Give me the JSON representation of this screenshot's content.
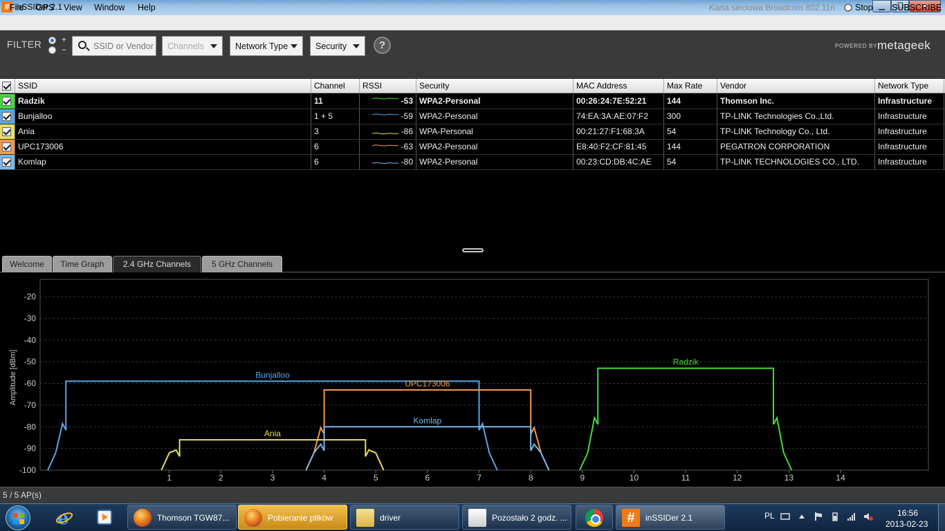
{
  "window": {
    "title": "inSSIDer 2.1",
    "app_icon": "#",
    "min_glyph": "▁",
    "max_glyph": "❐",
    "close_glyph": "✕"
  },
  "menu": {
    "items": [
      "File",
      "GPS",
      "View",
      "Window",
      "Help"
    ],
    "adapter": "Karta sieciowa Broadcom 802.11n",
    "stop": "Stop",
    "subscribe": "SUBSCRIBE"
  },
  "filter": {
    "label": "FILTER",
    "plus": "+",
    "minus": "−",
    "search_placeholder": "SSID or Vendor",
    "channels": "Channels",
    "network_type": "Network Type",
    "security": "Security",
    "help": "?",
    "powered_by": "POWERED BY",
    "brand": "metageek"
  },
  "table": {
    "columns": [
      "SSID",
      "Channel",
      "RSSI",
      "Security",
      "MAC Address",
      "Max Rate",
      "Vendor",
      "Network Type"
    ],
    "rows": [
      {
        "ssid": "Radzik",
        "channel": "11",
        "rssi": "-53",
        "security": "WPA2-Personal",
        "mac": "00:26:24:7E:52:21",
        "max_rate": "144",
        "vendor": "Thomson Inc.",
        "network_type": "Infrastructure",
        "color": "#44dd33",
        "selected": true
      },
      {
        "ssid": "Bunjalloo",
        "channel": "1 + 5",
        "rssi": "-59",
        "security": "WPA2-Personal",
        "mac": "74:EA:3A:AE:07:F2",
        "max_rate": "300",
        "vendor": "TP-LINK Technologies Co.,Ltd.",
        "network_type": "Infrastructure",
        "color": "#5aa6e6",
        "selected": false
      },
      {
        "ssid": "Ania",
        "channel": "3",
        "rssi": "-86",
        "security": "WPA-Personal",
        "mac": "00:21:27:F1:68:3A",
        "max_rate": "54",
        "vendor": "TP-LINK Technology Co., Ltd.",
        "network_type": "Infrastructure",
        "color": "#e8e05a",
        "selected": false
      },
      {
        "ssid": "UPC173006",
        "channel": "6",
        "rssi": "-63",
        "security": "WPA2-Personal",
        "mac": "E8:40:F2:CF:81:45",
        "max_rate": "144",
        "vendor": "PEGATRON CORPORATION",
        "network_type": "Infrastructure",
        "color": "#f29a4a",
        "selected": false
      },
      {
        "ssid": "Komlap",
        "channel": "6",
        "rssi": "-80",
        "security": "WPA2-Personal",
        "mac": "00:23:CD:DB:4C:AE",
        "max_rate": "54",
        "vendor": "TP-LINK TECHNOLOGIES CO., LTD.",
        "network_type": "Infrastructure",
        "color": "#78b8ee",
        "selected": false
      }
    ]
  },
  "tabs": [
    {
      "label": "Welcome",
      "active": false
    },
    {
      "label": "Time Graph",
      "active": false
    },
    {
      "label": "2.4 GHz Channels",
      "active": true
    },
    {
      "label": "5 GHz Channels",
      "active": false
    }
  ],
  "chart_data": {
    "type": "area",
    "ylabel": "Amplitude [dBm]",
    "xlabel": "",
    "ylim": [
      -100,
      -12
    ],
    "xlim": [
      -1.5,
      15.7
    ],
    "y_ticks": [
      -20,
      -30,
      -40,
      -50,
      -60,
      -70,
      -80,
      -90,
      -100
    ],
    "x_ticks": [
      1,
      2,
      3,
      4,
      5,
      6,
      7,
      8,
      9,
      10,
      11,
      12,
      13,
      14
    ],
    "grid": true,
    "series": [
      {
        "name": "Bunjalloo",
        "center": 3,
        "width": 8.0,
        "amplitude": -59,
        "color": "#5aa6e6"
      },
      {
        "name": "UPC173006",
        "center": 6,
        "width": 4.0,
        "amplitude": -63,
        "color": "#f29a4a"
      },
      {
        "name": "Komlap",
        "center": 6,
        "width": 4.0,
        "amplitude": -80,
        "color": "#78b8ee"
      },
      {
        "name": "Ania",
        "center": 3,
        "width": 3.6,
        "amplitude": -86,
        "color": "#e8e05a"
      },
      {
        "name": "Radzik",
        "center": 11,
        "width": 3.4,
        "amplitude": -53,
        "color": "#44dd33"
      }
    ]
  },
  "status": {
    "text": "5 / 5 AP(s)"
  },
  "taskbar": {
    "tasks": [
      {
        "id": "firefox1",
        "label": "Thomson TGW87..."
      },
      {
        "id": "firefox2",
        "label": "Pobieranie plików"
      },
      {
        "id": "folder",
        "label": "driver"
      },
      {
        "id": "transfer",
        "label": "Pozostało 2 godz. ..."
      },
      {
        "id": "chrome",
        "label": ""
      },
      {
        "id": "inssider",
        "label": "inSSIDer 2.1"
      }
    ],
    "lang": "PL",
    "time": "16:56",
    "date": "2013-02-23"
  }
}
